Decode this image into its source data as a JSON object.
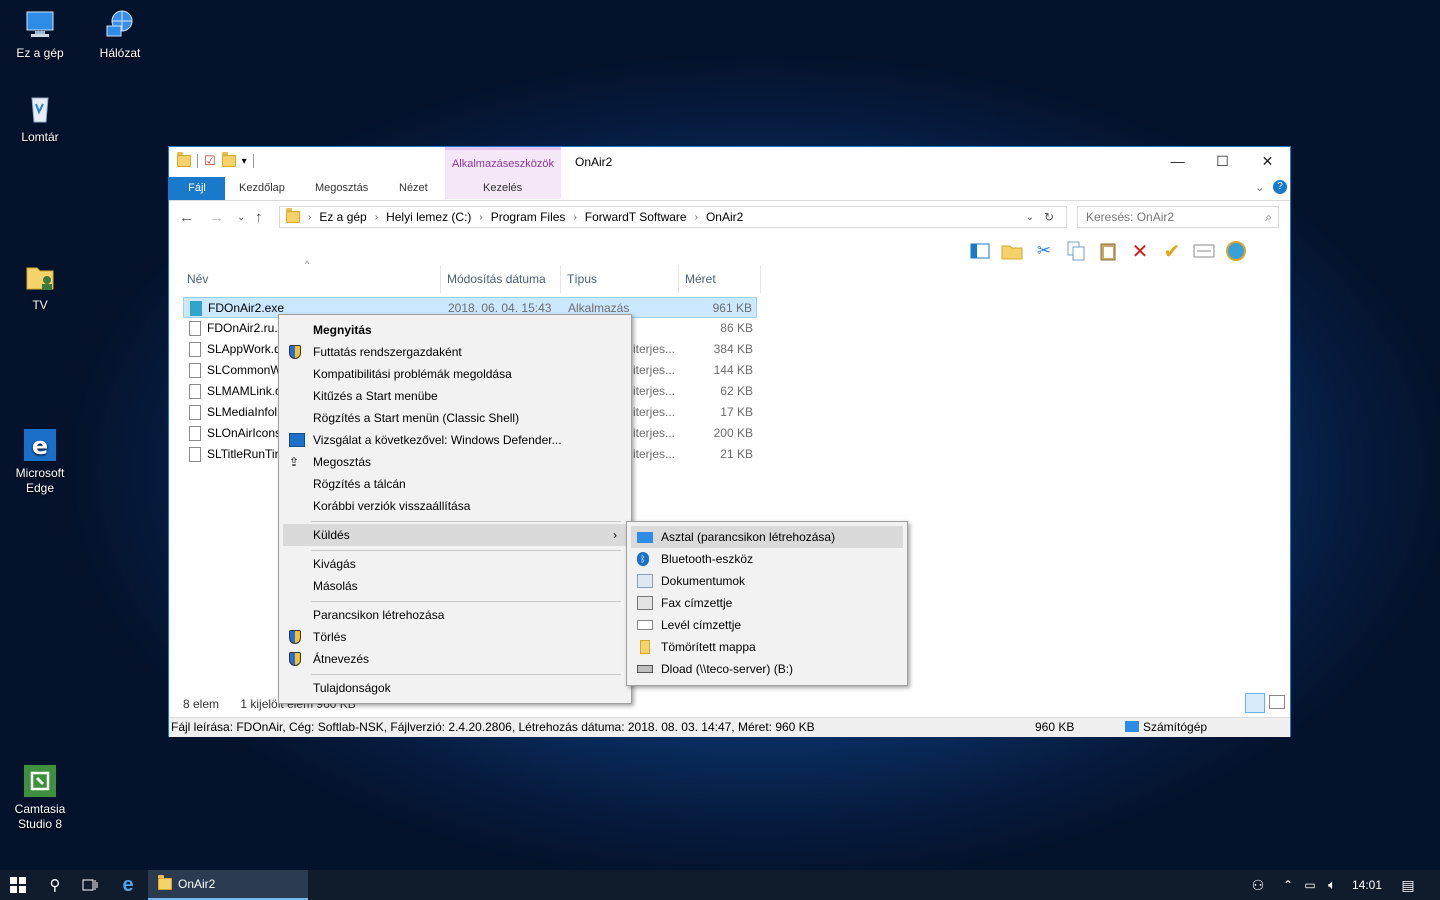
{
  "desktop": {
    "icons": [
      {
        "label": "Ez a gép",
        "icon": "computer-icon"
      },
      {
        "label": "Hálózat",
        "icon": "network-icon"
      },
      {
        "label": "Lomtár",
        "icon": "recycle-bin-icon"
      },
      {
        "label": "TV",
        "icon": "user-folder-icon"
      },
      {
        "label": "Microsoft Edge",
        "icon": "edge-icon"
      },
      {
        "label": "Camtasia Studio 8",
        "icon": "camtasia-icon"
      }
    ]
  },
  "window": {
    "title": "OnAir2",
    "context_tab_group": "Alkalmazáseszközök",
    "ribbon_tabs": [
      "Fájl",
      "Kezdőlap",
      "Megosztás",
      "Nézet",
      "Kezelés"
    ],
    "breadcrumb": [
      "Ez a gép",
      "Helyi lemez (C:)",
      "Program Files",
      "ForwardT Software",
      "OnAir2"
    ],
    "search_placeholder": "Keresés: OnAir2",
    "columns": [
      "Név",
      "Módosítás dátuma",
      "Típus",
      "Méret"
    ],
    "files": [
      {
        "name": "FDOnAir2.exe",
        "date": "2018. 06. 04. 15:43",
        "type": "Alkalmazás",
        "size": "961 KB"
      },
      {
        "name": "FDOnAir2.ru.x",
        "date": "",
        "type": "",
        "size": "86 KB"
      },
      {
        "name": "SLAppWork.d",
        "date": "",
        "type": "iterjes...",
        "size": "384 KB"
      },
      {
        "name": "SLCommonW",
        "date": "",
        "type": "iterjes...",
        "size": "144 KB"
      },
      {
        "name": "SLMAMLink.c",
        "date": "",
        "type": "iterjes...",
        "size": "62 KB"
      },
      {
        "name": "SLMediaInfol.",
        "date": "",
        "type": "iterjes...",
        "size": "17 KB"
      },
      {
        "name": "SLOnAirIcons",
        "date": "",
        "type": "iterjes...",
        "size": "200 KB"
      },
      {
        "name": "SLTitleRunTim",
        "date": "",
        "type": "iterjes...",
        "size": "21 KB"
      }
    ],
    "status_count": "8 elem",
    "status_selected": "1 kijelölt elem  960 KB",
    "footer_description": "Fájl leírása: FDOnAir, Cég: Softlab-NSK, Fájlverzió: 2.4.20.2806, Létrehozás dátuma: 2018. 08. 03. 14:47, Méret: 960 KB",
    "footer_size": "960 KB",
    "footer_location": "Számítógép"
  },
  "context_menu": {
    "items": [
      {
        "label": "Megnyitás",
        "bold": true
      },
      {
        "label": "Futtatás rendszergazdaként",
        "icon": "shield-icon"
      },
      {
        "label": "Kompatibilitási problémák megoldása"
      },
      {
        "label": "Kitűzés a Start menübe"
      },
      {
        "label": "Rögzítés a Start menün (Classic Shell)"
      },
      {
        "label": "Vizsgálat a következővel: Windows Defender...",
        "icon": "defender-icon"
      },
      {
        "label": "Megosztás",
        "icon": "share-icon"
      },
      {
        "label": "Rögzítés a tálcán"
      },
      {
        "label": "Korábbi verziók visszaállítása"
      },
      {
        "label": "Küldés"
      },
      {
        "label": "Kivágás"
      },
      {
        "label": "Másolás"
      },
      {
        "label": "Parancsikon létrehozása"
      },
      {
        "label": "Törlés",
        "icon": "shield-icon"
      },
      {
        "label": "Átnevezés",
        "icon": "shield-icon"
      },
      {
        "label": "Tulajdonságok"
      }
    ]
  },
  "send_to_menu": {
    "items": [
      {
        "label": "Asztal (parancsikon létrehozása)",
        "icon": "desktop-icon"
      },
      {
        "label": "Bluetooth-eszköz",
        "icon": "bluetooth-icon"
      },
      {
        "label": "Dokumentumok",
        "icon": "documents-icon"
      },
      {
        "label": "Fax címzettje",
        "icon": "fax-icon"
      },
      {
        "label": "Levél címzettje",
        "icon": "mail-icon"
      },
      {
        "label": "Tömörített mappa",
        "icon": "zip-folder-icon"
      },
      {
        "label": "Dload (\\\\teco-server) (B:)",
        "icon": "network-drive-icon"
      }
    ]
  },
  "taskbar": {
    "app_label": "OnAir2",
    "clock": "14:01"
  },
  "colors": {
    "accent": "#1979ca",
    "selection": "#cce8ff",
    "context_tab": "#f5e6f8",
    "taskbar": "#101b2b"
  }
}
